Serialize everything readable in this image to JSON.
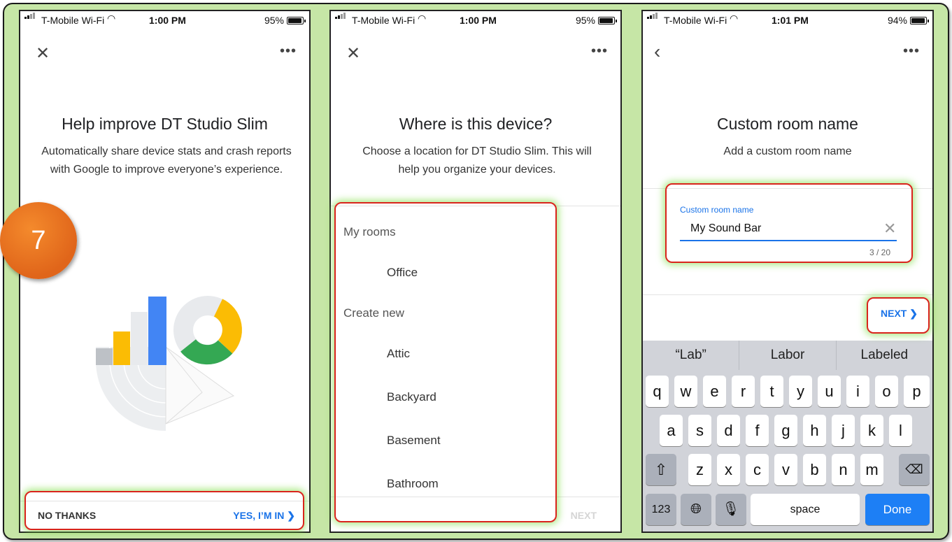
{
  "step_badge": "7",
  "status_bars": [
    {
      "carrier": "T-Mobile Wi-Fi",
      "time": "1:00 PM",
      "battery": "95%"
    },
    {
      "carrier": "T-Mobile Wi-Fi",
      "time": "1:00 PM",
      "battery": "95%"
    },
    {
      "carrier": "T-Mobile Wi-Fi",
      "time": "1:01 PM",
      "battery": "94%"
    }
  ],
  "screen1": {
    "title": "Help improve DT Studio Slim",
    "description": "Automatically share device stats and crash reports with Google to improve everyone’s experience.",
    "no_thanks": "NO THANKS",
    "yes": "YES, I’M IN"
  },
  "screen2": {
    "title": "Where is this device?",
    "description": "Choose a location for DT Studio Slim. This will help you organize your devices.",
    "sections": [
      {
        "header": "My rooms",
        "items": [
          "Office"
        ]
      },
      {
        "header": "Create new",
        "items": [
          "Attic",
          "Backyard",
          "Basement",
          "Bathroom"
        ]
      }
    ],
    "next": "NEXT"
  },
  "screen3": {
    "title": "Custom room name",
    "subtitle": "Add a custom room name",
    "field_label": "Custom room name",
    "field_value": "My Sound Bar",
    "counter": "3 / 20",
    "next": "NEXT",
    "suggestions": [
      "“Lab”",
      "Labor",
      "Labeled"
    ],
    "keyboard": {
      "row1": [
        "q",
        "w",
        "e",
        "r",
        "t",
        "y",
        "u",
        "i",
        "o",
        "p"
      ],
      "row2": [
        "a",
        "s",
        "d",
        "f",
        "g",
        "h",
        "j",
        "k",
        "l"
      ],
      "row3": [
        "z",
        "x",
        "c",
        "v",
        "b",
        "n",
        "m"
      ],
      "numbers": "123",
      "space": "space",
      "done": "Done"
    }
  },
  "colors": {
    "accent": "#1a73e8",
    "highlight": "#d9241c",
    "frame": "#c6e6a6",
    "badge": "#e8701f"
  }
}
